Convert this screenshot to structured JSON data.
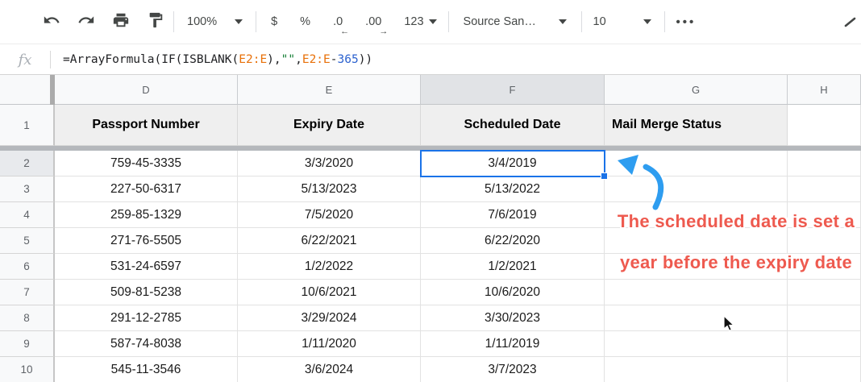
{
  "toolbar": {
    "zoom_value": "100%",
    "currency_label": "$",
    "percent_label": "%",
    "decrease_decimal_label": ".0",
    "decrease_decimal_arrow": "←",
    "increase_decimal_label": ".00",
    "increase_decimal_arrow": "→",
    "number_format_label": "123",
    "font_name": "Source San…",
    "font_size": "10",
    "more_label": "•••"
  },
  "formula_bar": {
    "fx_label": "fx",
    "segments": [
      {
        "text": "=ArrayFormula(IF(ISBLANK(",
        "color": "#202124"
      },
      {
        "text": "E2:E",
        "color": "#e8710a"
      },
      {
        "text": "),",
        "color": "#202124"
      },
      {
        "text": "\"\"",
        "color": "#188038"
      },
      {
        "text": ",",
        "color": "#202124"
      },
      {
        "text": "E2:E",
        "color": "#e8710a"
      },
      {
        "text": "-",
        "color": "#202124"
      },
      {
        "text": "365",
        "color": "#2c62cf"
      },
      {
        "text": "))",
        "color": "#202124"
      }
    ]
  },
  "grid": {
    "column_letters": [
      "D",
      "E",
      "F",
      "G",
      "H"
    ],
    "row1": {
      "num": "1",
      "d": "Passport Number",
      "e": "Expiry Date",
      "f": "Scheduled Date",
      "g": "Mail Merge Status",
      "h": ""
    },
    "rows": [
      {
        "num": "2",
        "d": "759-45-3335",
        "e": "3/3/2020",
        "f": "3/4/2019",
        "g": ""
      },
      {
        "num": "3",
        "d": "227-50-6317",
        "e": "5/13/2023",
        "f": "5/13/2022",
        "g": ""
      },
      {
        "num": "4",
        "d": "259-85-1329",
        "e": "7/5/2020",
        "f": "7/6/2019",
        "g": ""
      },
      {
        "num": "5",
        "d": "271-76-5505",
        "e": "6/22/2021",
        "f": "6/22/2020",
        "g": ""
      },
      {
        "num": "6",
        "d": "531-24-6597",
        "e": "1/2/2022",
        "f": "1/2/2021",
        "g": ""
      },
      {
        "num": "7",
        "d": "509-81-5238",
        "e": "10/6/2021",
        "f": "10/6/2020",
        "g": ""
      },
      {
        "num": "8",
        "d": "291-12-2785",
        "e": "3/29/2024",
        "f": "3/30/2023",
        "g": ""
      },
      {
        "num": "9",
        "d": "587-74-8038",
        "e": "1/11/2020",
        "f": "1/11/2019",
        "g": ""
      },
      {
        "num": "10",
        "d": "545-11-3546",
        "e": "3/6/2024",
        "f": "3/7/2023",
        "g": ""
      }
    ]
  },
  "annotation": {
    "line1": "The scheduled date is set a",
    "line2": "year before the expiry date"
  },
  "colors": {
    "selection_blue": "#1a73e8",
    "arrow_blue": "#2e9df0",
    "annotation_red": "#ee5a4f",
    "header_fill": "#efefef"
  }
}
